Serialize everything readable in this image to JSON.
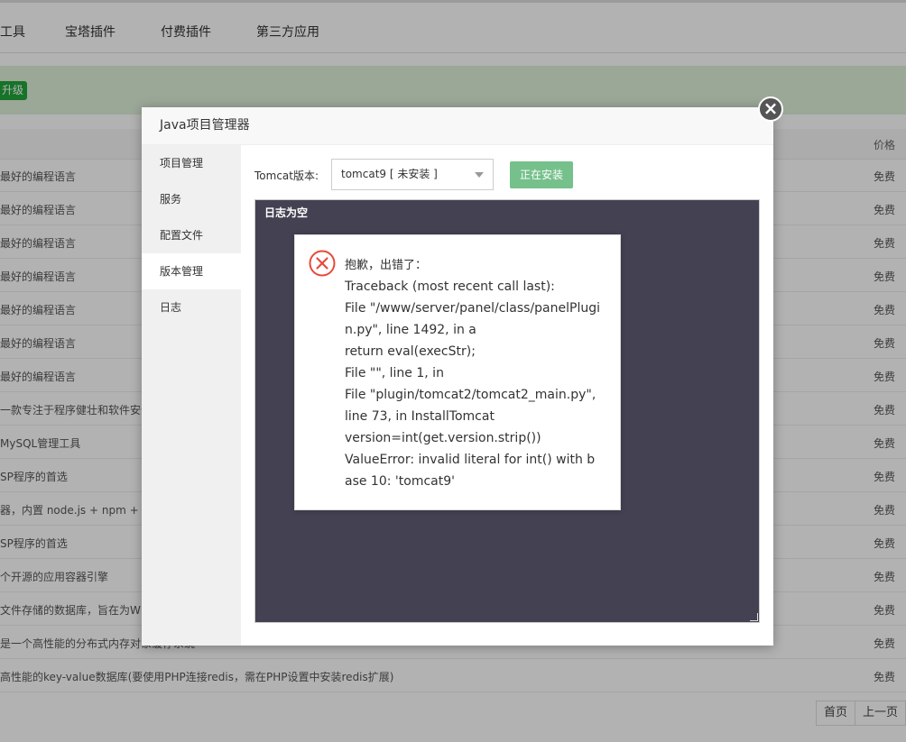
{
  "tabs": [
    "工具",
    "宝塔插件",
    "付费插件",
    "第三方应用"
  ],
  "banner_badge": "升级",
  "table": {
    "price_header": "价格",
    "rows": [
      {
        "desc": "最好的编程语言",
        "price": "免费"
      },
      {
        "desc": "最好的编程语言",
        "price": "免费"
      },
      {
        "desc": "最好的编程语言",
        "price": "免费"
      },
      {
        "desc": "最好的编程语言",
        "price": "免费"
      },
      {
        "desc": "最好的编程语言",
        "price": "免费"
      },
      {
        "desc": "最好的编程语言",
        "price": "免费"
      },
      {
        "desc": "最好的编程语言",
        "price": "免费"
      },
      {
        "desc": "一款专注于程序健壮和软件安全",
        "price": "免费"
      },
      {
        "desc": "MySQL管理工具",
        "price": "免费"
      },
      {
        "desc": "SP程序的首选",
        "price": "免费"
      },
      {
        "desc": "器，内置 node.js + npm + nv",
        "price": "免费"
      },
      {
        "desc": "SP程序的首选",
        "price": "免费"
      },
      {
        "desc": "个开源的应用容器引擎",
        "price": "免费"
      },
      {
        "desc": "文件存储的数据库，旨在为WEB",
        "price": "免费"
      },
      {
        "desc": "是一个高性能的分布式内存对象缓存系统",
        "price": "免费"
      },
      {
        "desc": "高性能的key-value数据库(要使用PHP连接redis，需在PHP设置中安装redis扩展)",
        "price": "免费"
      }
    ]
  },
  "pager": {
    "first": "首页",
    "prev": "上一页"
  },
  "dialog": {
    "title": "Java项目管理器",
    "close_glyph": "×",
    "sidebar": [
      "项目管理",
      "服务",
      "配置文件",
      "版本管理",
      "日志"
    ],
    "active_item": "版本管理",
    "version_label": "Tomcat版本:",
    "version_select": "tomcat9 [ 未安装 ]",
    "install_button": "正在安装",
    "log_text": "日志为空"
  },
  "error": {
    "title": "抱歉，出错了：",
    "lines": [
      "Traceback (most recent call last):",
      "File \"/www/server/panel/class/panelPlugin.py\", line 1492, in a",
      "return eval(execStr);",
      "File \"\", line 1, in",
      "File \"plugin/tomcat2/tomcat2_main.py\", line 73, in InstallTomcat",
      "version=int(get.version.strip())",
      "ValueError: invalid literal for int() with base 10: 'tomcat9'"
    ],
    "icon": "error-circle-x-icon"
  }
}
